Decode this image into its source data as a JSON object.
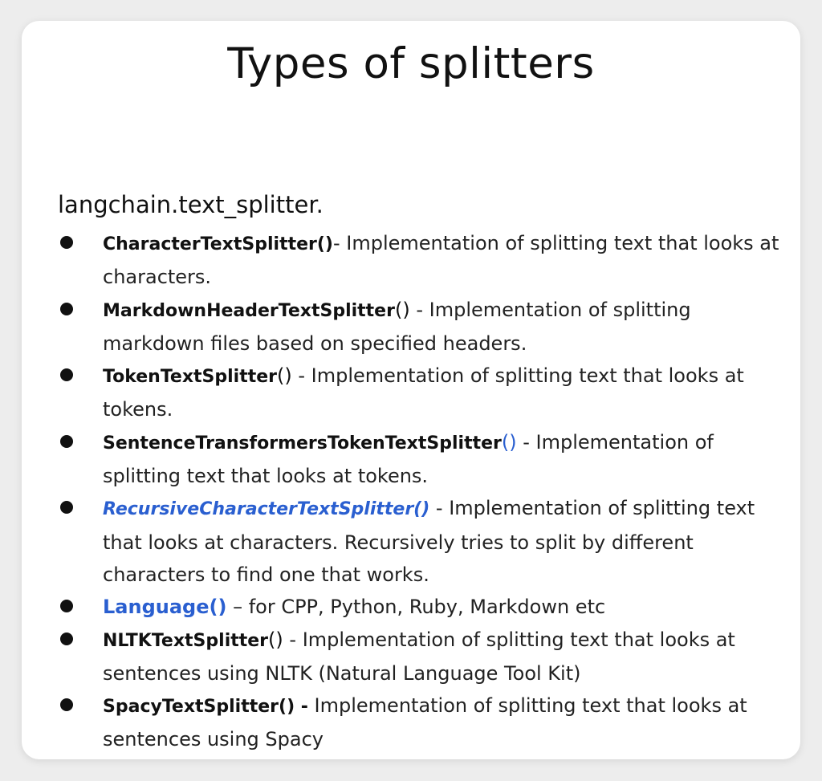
{
  "title": "Types of splitters",
  "module": "langchain.text_splitter.",
  "items": [
    {
      "name": "CharacterTextSplitter()",
      "paren": "",
      "desc": "- Implementation of splitting text that looks at characters."
    },
    {
      "name": "MarkdownHeaderTextSplitter",
      "paren": "()",
      "desc": " - Implementation of splitting markdown files based on specified headers."
    },
    {
      "name": "TokenTextSplitter",
      "paren": "()",
      "desc": " - Implementation of splitting text that looks at tokens."
    },
    {
      "name": "SentenceTransformersTokenTextSplitter",
      "paren": "()",
      "desc": " - Implementation of splitting text that looks at tokens."
    },
    {
      "name": "RecursiveCharacterTextSplitter()",
      "paren": "",
      "desc": " - Implementation of splitting text that looks at characters. Recursively tries to split by different characters to find one that works."
    },
    {
      "name": "Language()",
      "paren": "",
      "desc": " – for CPP, Python, Ruby, Markdown etc"
    },
    {
      "name": "NLTKTextSplitter",
      "paren": "()",
      "desc": " - Implementation of splitting text that looks at sentences using NLTK (Natural Language Tool Kit)"
    },
    {
      "name": "SpacyTextSplitter() -",
      "paren": "",
      "desc": " Implementation of splitting text that looks at sentences using Spacy"
    }
  ],
  "colors": {
    "link_blue": "#2a5fd0",
    "text": "#222222",
    "background": "#ffffff"
  }
}
